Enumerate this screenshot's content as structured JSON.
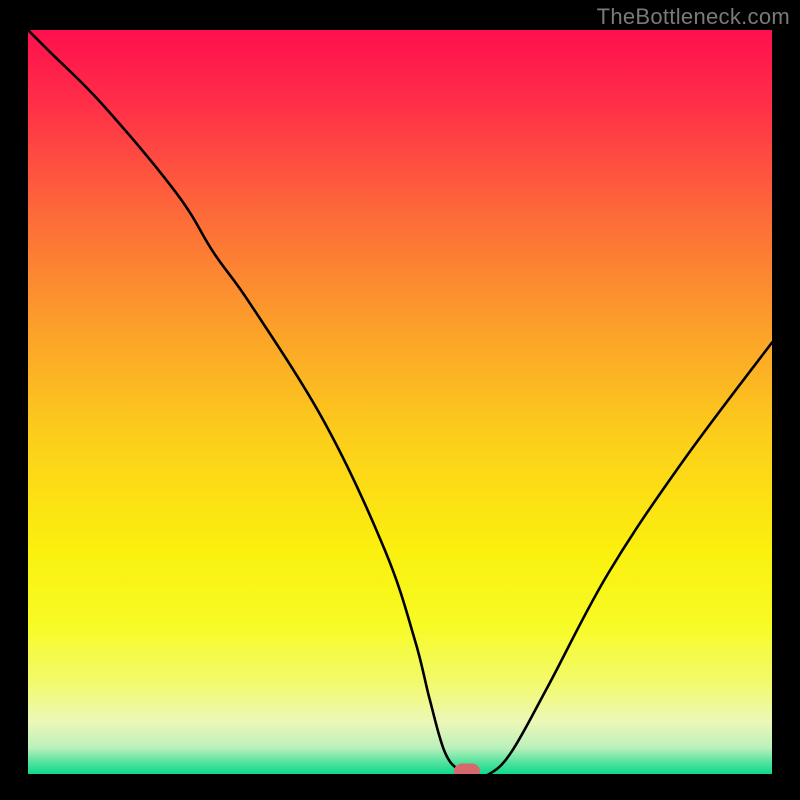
{
  "watermark": "TheBottleneck.com",
  "colors": {
    "page_bg": "#000000",
    "curve": "#000000",
    "marker": "#d6696b"
  },
  "gradient_stops": [
    {
      "offset": 0.0,
      "color": "#ff0f4e"
    },
    {
      "offset": 0.1,
      "color": "#ff2f48"
    },
    {
      "offset": 0.25,
      "color": "#fd6b39"
    },
    {
      "offset": 0.4,
      "color": "#fca02a"
    },
    {
      "offset": 0.55,
      "color": "#fccf1a"
    },
    {
      "offset": 0.7,
      "color": "#fbf00e"
    },
    {
      "offset": 0.8,
      "color": "#f7fb25"
    },
    {
      "offset": 0.88,
      "color": "#f2fa70"
    },
    {
      "offset": 0.93,
      "color": "#ecf8b8"
    },
    {
      "offset": 0.965,
      "color": "#b9f0ba"
    },
    {
      "offset": 0.985,
      "color": "#4fe29e"
    },
    {
      "offset": 1.0,
      "color": "#0fd98c"
    }
  ],
  "chart_data": {
    "type": "line",
    "title": "",
    "xlabel": "",
    "ylabel": "",
    "xlim": [
      0,
      100
    ],
    "ylim": [
      0,
      100
    ],
    "grid": false,
    "legend": false,
    "x": [
      0,
      3,
      10,
      20,
      25,
      30,
      40,
      48,
      52,
      54,
      56,
      58,
      60,
      62,
      65,
      70,
      78,
      88,
      100
    ],
    "values": [
      100,
      97,
      90,
      78,
      70,
      63,
      47,
      30,
      18,
      10,
      3,
      0.5,
      0,
      0,
      3,
      12,
      27,
      42,
      58
    ],
    "marker": {
      "x": 59,
      "y": 0,
      "w": 3.5,
      "h": 2.3
    },
    "notes": "V-shaped bottleneck curve; minimum (optimal point) near x≈59, marked by rounded red pill at bottom. Values are % of chart height (0=bottom green, 100=top red). Readings estimated from pixels."
  }
}
